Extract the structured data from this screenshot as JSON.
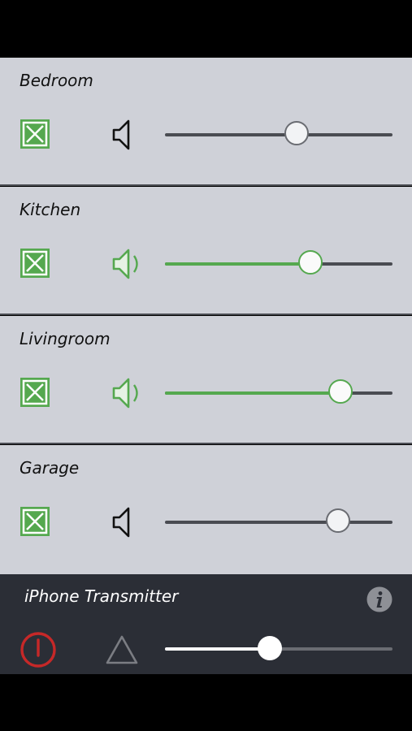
{
  "zones": [
    {
      "name": "Bedroom",
      "speaker_icon": "speaker-box-icon",
      "volume_icon": "speaker-muted-icon",
      "active": false,
      "volume": 0.58
    },
    {
      "name": "Kitchen",
      "speaker_icon": "speaker-box-icon",
      "volume_icon": "speaker-active-icon",
      "active": true,
      "volume": 0.64
    },
    {
      "name": "Livingroom",
      "speaker_icon": "speaker-box-icon",
      "volume_icon": "speaker-active-icon",
      "active": true,
      "volume": 0.77
    },
    {
      "name": "Garage",
      "speaker_icon": "speaker-box-icon",
      "volume_icon": "speaker-muted-icon",
      "active": false,
      "volume": 0.76
    }
  ],
  "transmitter": {
    "name": "iPhone Transmitter",
    "info_icon": "info-icon",
    "power_icon": "power-icon",
    "warning_icon": "warning-triangle-icon",
    "volume": 0.46
  },
  "colors": {
    "accent_green": "#55a84f",
    "power_red": "#c62828",
    "zone_background": "#cfd1d8",
    "transmitter_background": "#2b2e36"
  }
}
